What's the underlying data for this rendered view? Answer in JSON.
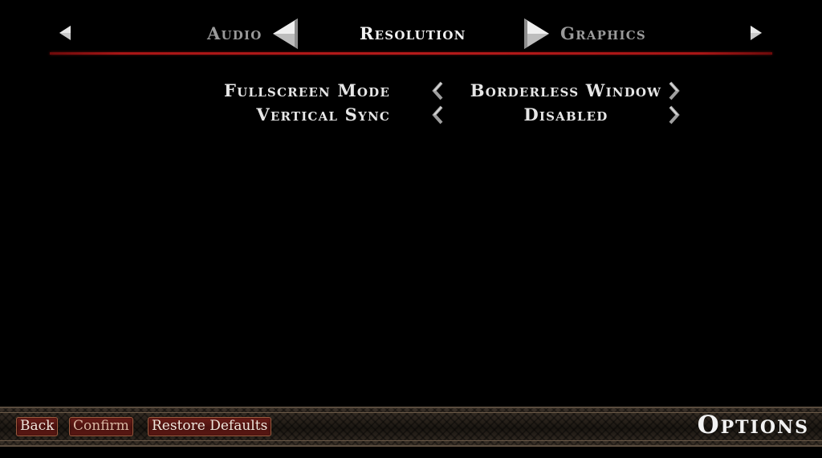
{
  "tabs": {
    "prev": "Audio",
    "current": "Resolution",
    "next": "Graphics"
  },
  "settings": [
    {
      "label": "Fullscreen Mode",
      "value": "Borderless Window"
    },
    {
      "label": "Vertical Sync",
      "value": "Disabled"
    }
  ],
  "footer": {
    "back_label": "Back",
    "confirm_label": "Confirm",
    "restore_label": "Restore Defaults",
    "screen_title": "Options"
  },
  "colors": {
    "accent_red": "#b51a1a",
    "button_red": "#5a1813",
    "text": "#e6e6e6",
    "inactive_text": "#9a9a9a"
  },
  "icons": {
    "scroll_left": "small-left-arrow-icon",
    "scroll_right": "small-right-arrow-icon",
    "prev_tab": "big-left-arrow-icon",
    "next_tab": "big-right-arrow-icon",
    "decrease": "chevron-left-icon",
    "increase": "chevron-right-icon"
  }
}
